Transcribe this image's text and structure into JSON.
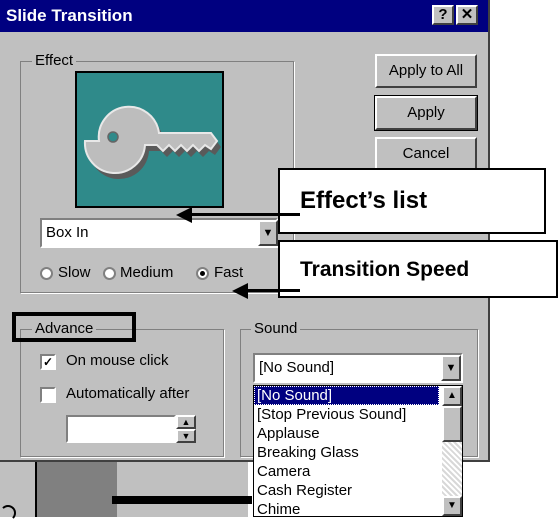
{
  "dialog": {
    "title": "Slide Transition",
    "help_label": "?",
    "close_label": "✕"
  },
  "effect_group": {
    "label": "Effect",
    "selected_effect": "Box In",
    "speeds": [
      {
        "label": "Slow",
        "selected": false
      },
      {
        "label": "Medium",
        "selected": false
      },
      {
        "label": "Fast",
        "selected": true
      }
    ]
  },
  "buttons": {
    "apply_all": "Apply to All",
    "apply": "Apply",
    "cancel": "Cancel"
  },
  "advance_group": {
    "label": "Advance",
    "on_mouse_click": "On mouse click",
    "on_mouse_click_checked": true,
    "automatically_after": "Automatically after",
    "automatically_after_checked": false,
    "seconds_value": ""
  },
  "sound_group": {
    "label": "Sound",
    "selected_sound": "[No Sound]",
    "options": [
      "[No Sound]",
      "[Stop Previous Sound]",
      "Applause",
      "Breaking Glass",
      "Camera",
      "Cash Register",
      "Chime"
    ]
  },
  "callouts": {
    "effects_list": "Effect’s list",
    "transition_speed": "Transition Speed"
  },
  "icons": {
    "preview": "key-icon",
    "dropdown": "chevron-down-icon",
    "spin": "spinner-icon"
  },
  "colors": {
    "titlebar": "#000080",
    "preview_bg": "#2f8a8a",
    "face": "#c0c0c0"
  }
}
